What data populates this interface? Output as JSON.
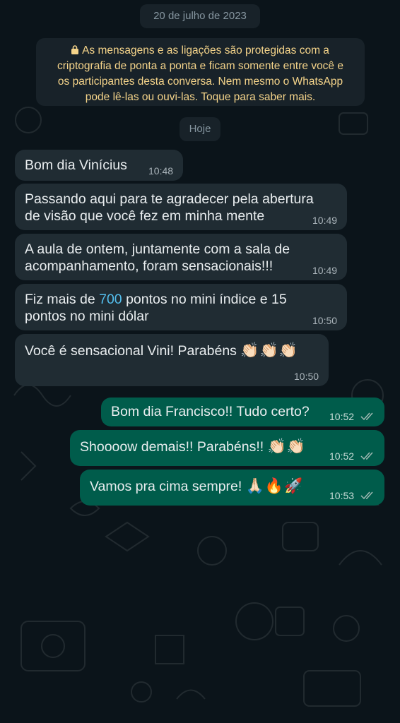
{
  "chat": {
    "date_separator": "20 de julho de 2023",
    "encryption_notice": {
      "line1": "As mensagens e as ligações são protegidas com a",
      "line2": "criptografia de ponta a ponta e ficam somente entre você e",
      "line3": "os participantes desta conversa. Nem mesmo o WhatsApp",
      "line4": "pode lê-las ou ouvi-las. Toque para saber mais."
    },
    "today_separator": "Hoje",
    "messages": [
      {
        "direction": "incoming",
        "lines": [
          "Bom dia Vinícius"
        ],
        "time": "10:48"
      },
      {
        "direction": "incoming",
        "lines": [
          "Passando aqui para te agradecer pela abertura",
          "de visão que você fez em minha mente"
        ],
        "time": "10:49"
      },
      {
        "direction": "incoming",
        "lines": [
          "A aula de ontem, juntamente com a sala de",
          "acompanhamento, foram sensacionais!!!"
        ],
        "time": "10:49"
      },
      {
        "direction": "incoming",
        "line1_before": "Fiz mais de ",
        "line1_highlight": "700",
        "line1_after": " pontos no mini índice e 15",
        "line2": "pontos no mini dólar",
        "time": "10:50"
      },
      {
        "direction": "incoming",
        "text": "Você é sensacional Vini! Parabéns",
        "emoji": "👏🏻👏🏻👏🏻",
        "time": "10:50"
      },
      {
        "direction": "outgoing",
        "text": "Bom dia Francisco!! Tudo certo?",
        "time": "10:52",
        "status": "read"
      },
      {
        "direction": "outgoing",
        "text": "Shoooow demais!! Parabéns!!",
        "emoji": "👏🏻👏🏻",
        "time": "10:52",
        "status": "read"
      },
      {
        "direction": "outgoing",
        "text": "Vamos pra cima sempre!",
        "emoji": "🙏🏻🔥🚀",
        "time": "10:53",
        "status": "read"
      }
    ]
  },
  "colors": {
    "background": "#0b141a",
    "incoming_bubble": "#202c33",
    "outgoing_bubble": "#005c4b",
    "system_pill": "#182229",
    "notice_text": "#f5d48a",
    "link_highlight": "#53bdeb"
  },
  "icons": {
    "lock": "lock-icon",
    "read_receipt": "double-check-icon"
  }
}
